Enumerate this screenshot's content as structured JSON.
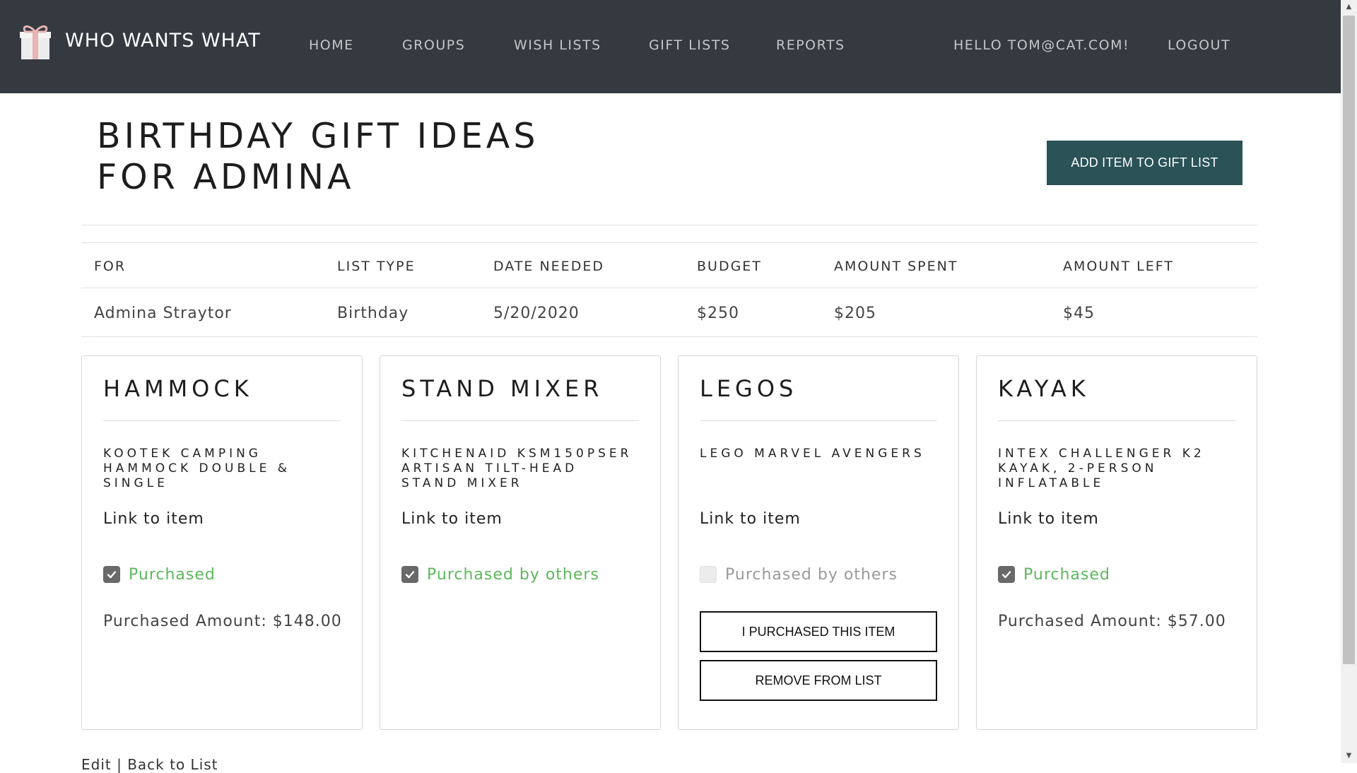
{
  "navbar": {
    "brand": "WHO WANTS WHAT",
    "links": [
      "HOME",
      "GROUPS",
      "WISH LISTS",
      "GIFT LISTS",
      "REPORTS"
    ],
    "greeting": "HELLO TOM@CAT.COM!",
    "logout": "LOGOUT"
  },
  "header": {
    "title": "BIRTHDAY GIFT IDEAS FOR ADMINA",
    "add_button": "ADD ITEM TO GIFT LIST"
  },
  "info": {
    "headers": [
      "FOR",
      "LIST TYPE",
      "DATE NEEDED",
      "BUDGET",
      "AMOUNT SPENT",
      "AMOUNT LEFT"
    ],
    "values": [
      "Admina Straytor",
      "Birthday",
      "5/20/2020",
      "$250",
      "$205",
      "$45"
    ]
  },
  "cards": [
    {
      "title": "HAMMOCK",
      "description": "KOOTEK CAMPING HAMMOCK DOUBLE & SINGLE",
      "link": "Link to item",
      "status": "Purchased",
      "checked": true,
      "amount": "Purchased Amount: $148.00"
    },
    {
      "title": "STAND MIXER",
      "description": "KITCHENAID KSM150PSER ARTISAN TILT-HEAD STAND MIXER",
      "link": "Link to item",
      "status": "Purchased by others",
      "checked": true
    },
    {
      "title": "LEGOS",
      "description": "LEGO MARVEL AVENGERS",
      "link": "Link to item",
      "status": "Purchased by others",
      "checked": false,
      "purchase_button": "I PURCHASED THIS ITEM",
      "remove_button": "REMOVE FROM LIST"
    },
    {
      "title": "KAYAK",
      "description": "INTEX CHALLENGER K2 KAYAK, 2-PERSON INFLATABLE",
      "link": "Link to item",
      "status": "Purchased",
      "checked": true,
      "amount": "Purchased Amount: $57.00"
    }
  ],
  "footer": {
    "edit": "Edit",
    "separator": "|",
    "back": "Back to List"
  },
  "colors": {
    "navbar": "#343a40",
    "accent_button": "#2a5257",
    "status_green": "#5cb85c"
  },
  "icons": {
    "brand": "gift-icon",
    "check": "check-icon"
  }
}
